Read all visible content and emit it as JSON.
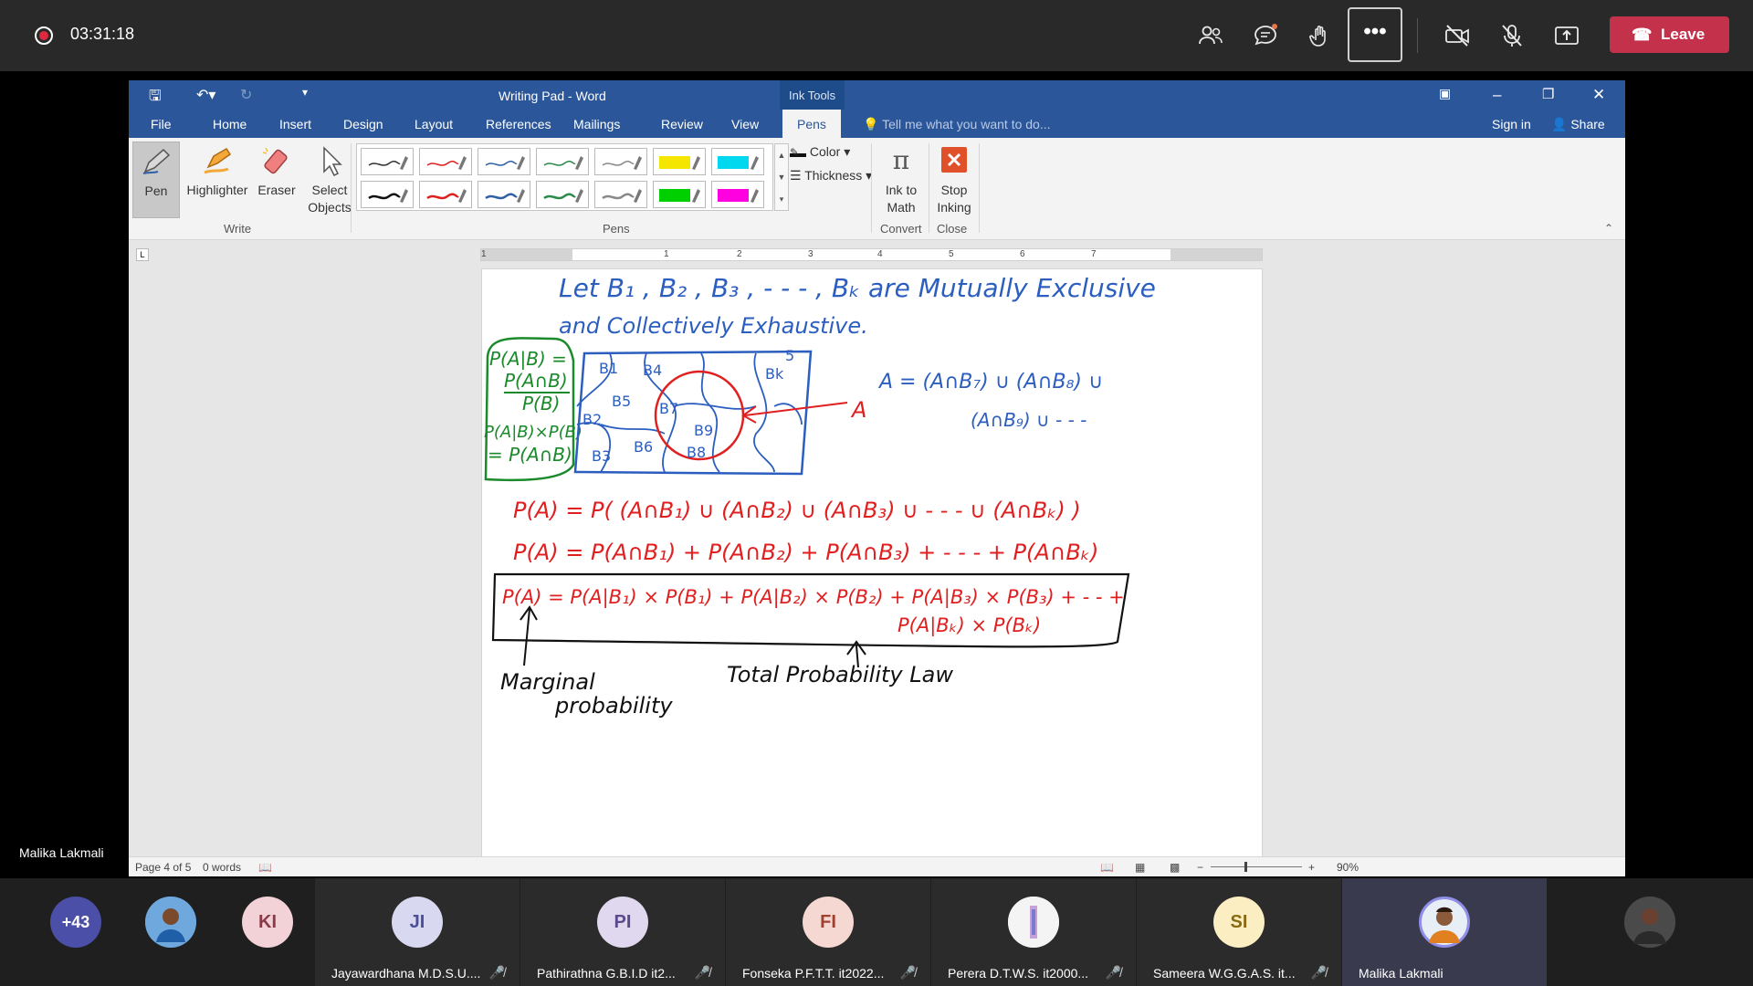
{
  "meeting": {
    "timer": "03:31:18",
    "more_label": "•••",
    "leave_label": "Leave",
    "presenter_name": "Malika Lakmali"
  },
  "word": {
    "title": "Writing Pad - Word",
    "contextual_tab": "Ink Tools",
    "menu": [
      "File",
      "Home",
      "Insert",
      "Design",
      "Layout",
      "References",
      "Mailings",
      "Review",
      "View",
      "Pens"
    ],
    "active_menu": "Pens",
    "tell_me": "Tell me what you want to do...",
    "sign_in": "Sign in",
    "share": "Share",
    "ribbon": {
      "pen": "Pen",
      "highlighter": "Highlighter",
      "eraser": "Eraser",
      "select_objects_1": "Select",
      "select_objects_2": "Objects",
      "write_group": "Write",
      "pens_group": "Pens",
      "color": "Color",
      "thickness": "Thickness",
      "ink_to_math_1": "Ink to",
      "ink_to_math_2": "Math",
      "convert_group": "Convert",
      "stop_inking_1": "Stop",
      "stop_inking_2": "Inking",
      "close_group": "Close",
      "pen_colors": [
        "#333333",
        "#e02020",
        "#3060a8",
        "#2a8a4a",
        "#888888",
        "#f5e600",
        "#00d8f0",
        "#111111",
        "#e02020",
        "#3060a8",
        "#2a8a4a",
        "#888888",
        "#00d000",
        "#ff00e0"
      ]
    },
    "ruler_numbers": [
      "1",
      "1",
      "2",
      "3",
      "4",
      "5",
      "6",
      "7"
    ],
    "status": {
      "page": "Page 4 of 5",
      "words": "0 words",
      "zoom": "90%"
    },
    "ink": {
      "line1": "Let   B₁ , B₂ , B₃ , - - - , Bₖ   are   Mutually   Exclusive",
      "line2": "and   Collectively   Exhaustive.",
      "green1": "P(A|B) =",
      "green2": "P(A∩B)",
      "green3": "P(B)",
      "green4": "P(A|B)×P(B)",
      "green5": "= P(A∩B)",
      "venn_labels": [
        "B1",
        "B4",
        "B5",
        "B7",
        "B9",
        "B2",
        "B3",
        "B6",
        "B8",
        "Bk",
        "5"
      ],
      "a_label": "A",
      "a_eq1": "A = (A∩B₇) ∪ (A∩B₈) ∪",
      "a_eq2": "(A∩B₉) ∪ - - -",
      "eq1": "P(A)  =  P( (A∩B₁) ∪ (A∩B₂) ∪ (A∩B₃) ∪ - - - ∪ (A∩Bₖ) )",
      "eq2": "P(A)  =  P(A∩B₁) + P(A∩B₂) + P(A∩B₃) + - - - + P(A∩Bₖ)",
      "eq3a": "P(A)  = P(A|B₁) × P(B₁)  +  P(A|B₂) × P(B₂) + P(A|B₃) × P(B₃) + - - +",
      "eq3b": "P(A|Bₖ) × P(Bₖ)",
      "marginal1": "Marginal",
      "marginal2": "probability",
      "total_law": "Total   Probability   Law"
    }
  },
  "participants": {
    "overflow": "+43",
    "initials_ki": "KI",
    "tiles": [
      {
        "initials": "JI",
        "name": "Jayawardhana M.D.S.U...."
      },
      {
        "initials": "PI",
        "name": "Pathirathna G.B.I.D it2..."
      },
      {
        "initials": "FI",
        "name": "Fonseka P.F.T.T. it2022..."
      },
      {
        "initials": "",
        "name": "Perera D.T.W.S. it2000..."
      },
      {
        "initials": "SI",
        "name": "Sameera W.G.G.A.S. it..."
      },
      {
        "initials": "",
        "name": "Malika Lakmali"
      }
    ]
  }
}
